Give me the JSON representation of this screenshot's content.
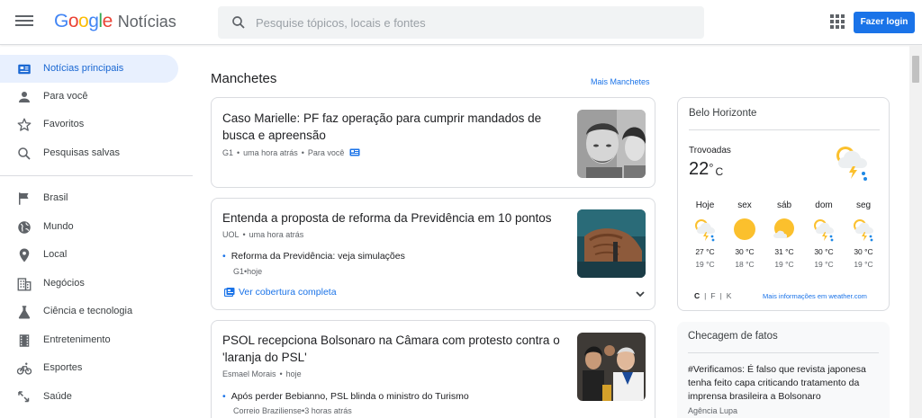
{
  "header": {
    "logo_letters": [
      "G",
      "o",
      "o",
      "g",
      "l",
      "e"
    ],
    "product": "Notícias",
    "search_placeholder": "Pesquise tópicos, locais e fontes",
    "login_label": "Fazer login"
  },
  "sidebar": {
    "items": [
      {
        "label": "Notícias principais",
        "icon": "top-stories-icon",
        "active": true
      },
      {
        "label": "Para você",
        "icon": "person-icon"
      },
      {
        "label": "Favoritos",
        "icon": "star-icon"
      },
      {
        "label": "Pesquisas salvas",
        "icon": "search-icon"
      },
      {
        "label": "Brasil",
        "icon": "flag-icon"
      },
      {
        "label": "Mundo",
        "icon": "globe-icon"
      },
      {
        "label": "Local",
        "icon": "location-pin-icon"
      },
      {
        "label": "Negócios",
        "icon": "building-icon"
      },
      {
        "label": "Ciência e tecnologia",
        "icon": "flask-icon"
      },
      {
        "label": "Entretenimento",
        "icon": "film-icon"
      },
      {
        "label": "Esportes",
        "icon": "bike-icon"
      },
      {
        "label": "Saúde",
        "icon": "health-icon"
      }
    ]
  },
  "main": {
    "section_title": "Manchetes",
    "more_link": "Mais Manchetes",
    "articles": [
      {
        "title_line1": "Caso Marielle: PF faz operação para cumprir mandados de",
        "title_line2": "busca e apreensão",
        "source": "G1",
        "time": "uma hora atrás",
        "tag": "Para você"
      },
      {
        "title_line1": "Entenda a proposta de reforma da Previdência em 10 pontos",
        "source": "UOL",
        "time": "uma hora atrás",
        "sub_title": "Reforma da Previdência: veja simulações",
        "sub_source": "G1",
        "sub_time": "hoje",
        "coverage": "Ver cobertura completa"
      },
      {
        "title_line1": "PSOL recepciona Bolsonaro na Câmara com protesto contra o",
        "title_line2": "'laranja do PSL'",
        "source": "Esmael Morais",
        "time": "hoje",
        "sub_title": "Após perder Bebianno, PSL blinda o ministro do Turismo",
        "sub_source": "Correio Braziliense",
        "sub_time": "3 horas atrás"
      }
    ]
  },
  "weather": {
    "city": "Belo Horizonte",
    "condition": "Trovoadas",
    "temp": "22",
    "deg": "°",
    "unit": "C",
    "days": [
      {
        "name": "Hoje",
        "hi": "27 °C",
        "lo": "19 °C",
        "icon": "storm-icon"
      },
      {
        "name": "sex",
        "hi": "30 °C",
        "lo": "18 °C",
        "icon": "sun-icon"
      },
      {
        "name": "sáb",
        "hi": "31 °C",
        "lo": "19 °C",
        "icon": "partly-sunny-icon"
      },
      {
        "name": "dom",
        "hi": "30 °C",
        "lo": "19 °C",
        "icon": "storm-icon"
      },
      {
        "name": "seg",
        "hi": "30 °C",
        "lo": "19 °C",
        "icon": "storm-icon"
      }
    ],
    "unit_c": "C",
    "unit_f": "F",
    "unit_k": "K",
    "sep": "|",
    "more_link": "Mais informações em weather.com"
  },
  "facts": {
    "title": "Checagem de fatos",
    "headline": "#Verificamos: É falso que revista japonesa tenha feito capa criticando tratamento da imprensa brasileira a Bolsonaro",
    "source": "Agência Lupa"
  },
  "colors": {
    "accent": "#1a73e8",
    "active_bg": "#e8f0fe",
    "border": "#dadce0"
  }
}
